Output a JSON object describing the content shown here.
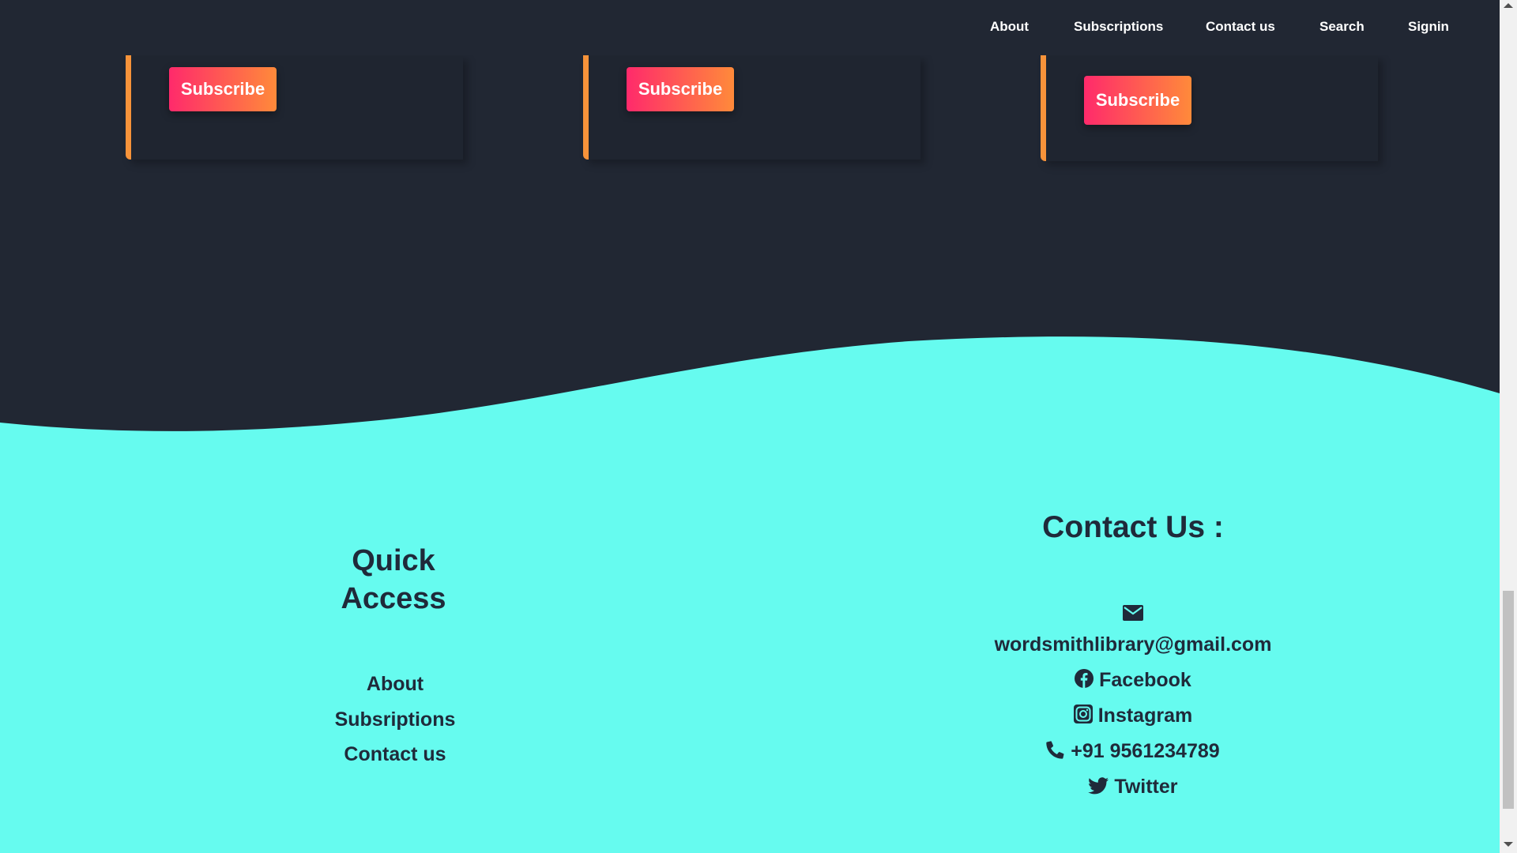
{
  "nav": {
    "items": [
      "About",
      "Subscriptions",
      "Contact us",
      "Search",
      "Signin"
    ]
  },
  "cards": {
    "subscribe_label": "Subscribe"
  },
  "footer": {
    "quick_access": {
      "title_line1": "Quick",
      "title_line2": "Access",
      "links": [
        "About",
        "Subsriptions",
        "Contact us"
      ]
    },
    "contact": {
      "title": "Contact Us :",
      "email": "wordsmithlibrary@gmail.com",
      "facebook": "Facebook",
      "instagram": "Instagram",
      "phone": "+91 9561234789",
      "twitter": "Twitter"
    }
  },
  "colors": {
    "background": "#212733",
    "footer": "#66fbef",
    "accent_border": "#f7933a",
    "button_gradient_start": "#ff2a6b",
    "button_gradient_end": "#ff8a3a",
    "footer_text": "#1f2a3a"
  },
  "icons": {
    "email": "envelope-icon",
    "facebook": "facebook-icon",
    "instagram": "instagram-icon",
    "phone": "phone-icon",
    "twitter": "twitter-icon"
  }
}
